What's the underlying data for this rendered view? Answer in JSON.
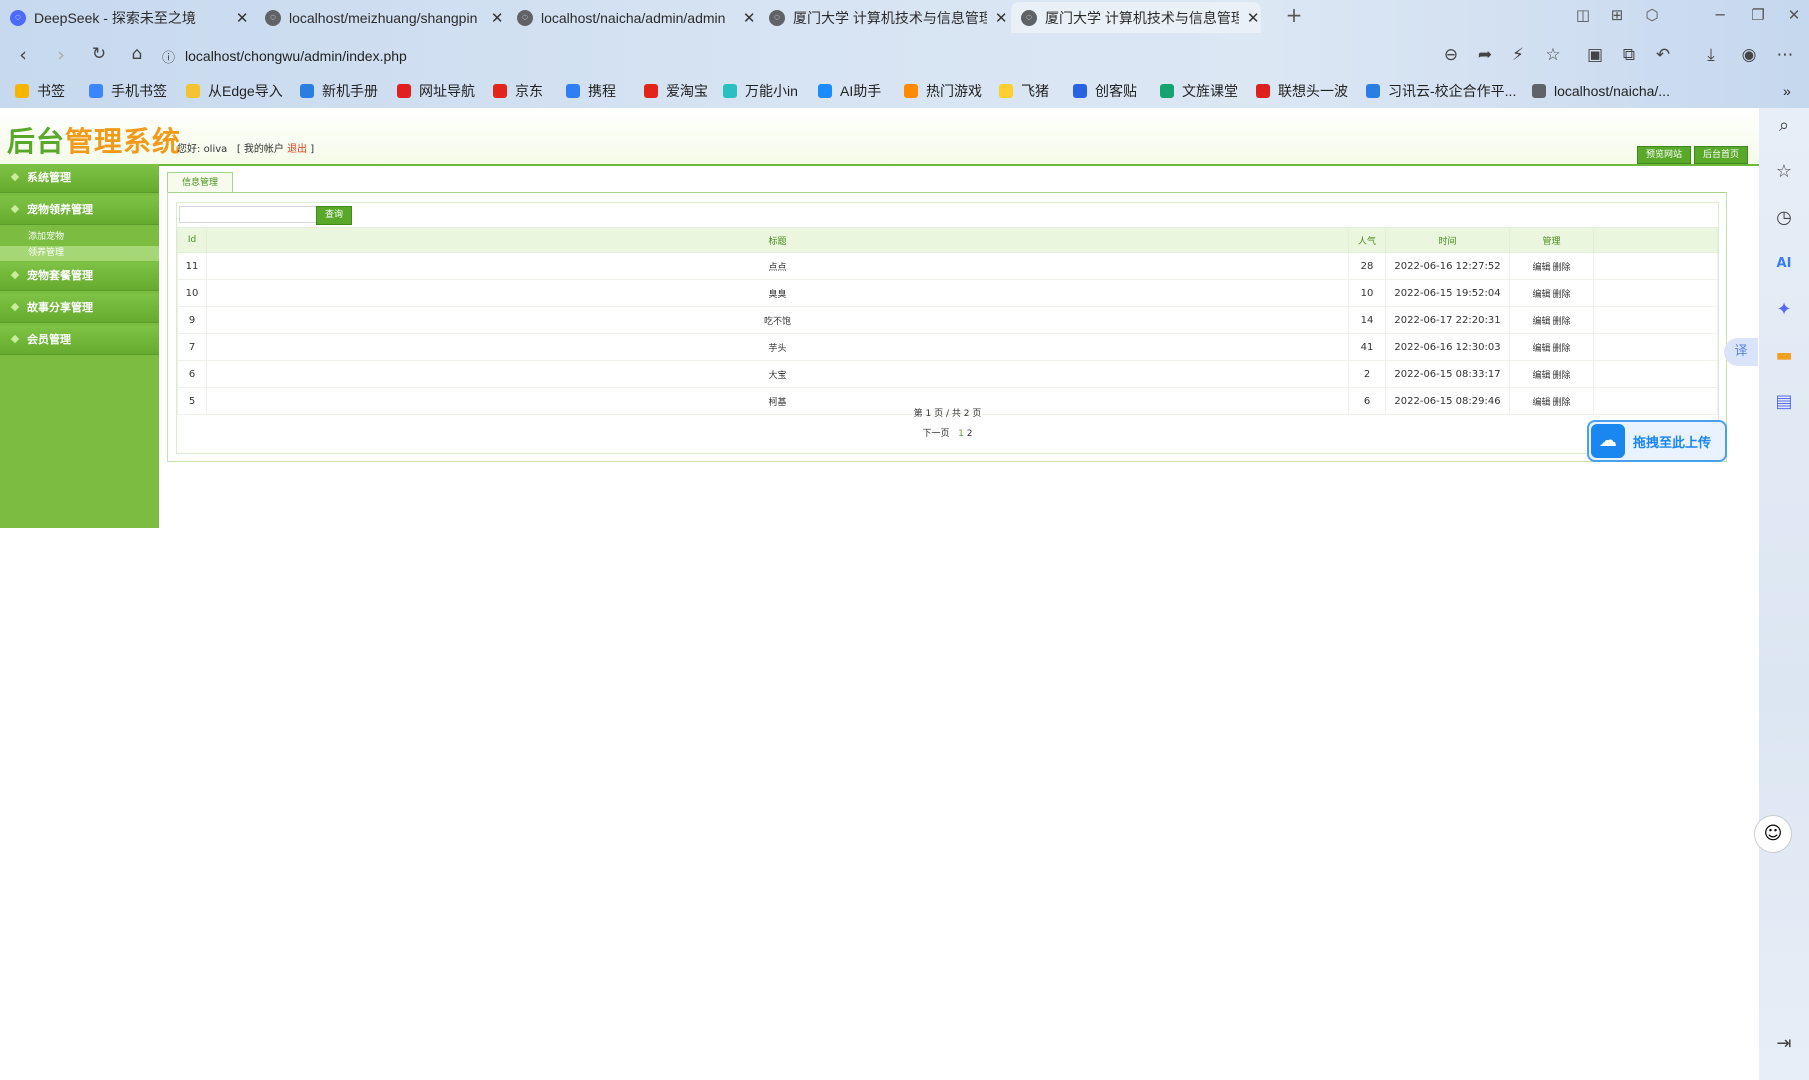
{
  "browser": {
    "tabs": [
      {
        "label": "DeepSeek - 探索未至之境",
        "color": "#4d6bfe"
      },
      {
        "label": "localhost/meizhuang/shangpin",
        "color": "#5f6368"
      },
      {
        "label": "localhost/naicha/admin/admin",
        "color": "#5f6368"
      },
      {
        "label": "厦门大学   计算机技术与信息管理",
        "color": "#5f6368"
      },
      {
        "label": "厦门大学   计算机技术与信息管理",
        "color": "#5f6368"
      }
    ],
    "new_tab": "+",
    "url": "localhost/chongwu/admin/index.php",
    "bookmarks": [
      {
        "label": "书签",
        "color": "#f7b500"
      },
      {
        "label": "手机书签",
        "color": "#3a86ff"
      },
      {
        "label": "从Edge导入",
        "color": "#f4c430"
      },
      {
        "label": "新机手册",
        "color": "#2a7de1"
      },
      {
        "label": "网址导航",
        "color": "#e02020"
      },
      {
        "label": "京东",
        "color": "#e1251b"
      },
      {
        "label": "携程",
        "color": "#2f7ef6"
      },
      {
        "label": "爱淘宝",
        "color": "#e1251b"
      },
      {
        "label": "万能小in",
        "color": "#2ac0c0"
      },
      {
        "label": "AI助手",
        "color": "#1a8cff"
      },
      {
        "label": "热门游戏",
        "color": "#ff8a00"
      },
      {
        "label": "飞猪",
        "color": "#ffcf2e"
      },
      {
        "label": "创客贴",
        "color": "#2b62e3"
      },
      {
        "label": "文旌课堂",
        "color": "#15a36f"
      },
      {
        "label": "联想头一波",
        "color": "#e02020"
      },
      {
        "label": "习讯云-校企合作平...",
        "color": "#2a7de1"
      },
      {
        "label": "localhost/naicha/...",
        "color": "#5f6368"
      }
    ],
    "more": "»"
  },
  "admin": {
    "logo_part1": "后台",
    "logo_part2": "管理系统",
    "welcome_prefix": "您好: ",
    "username": "oliva",
    "account_prefix": "[ 我的帐户 ",
    "logout": "退出",
    "account_suffix": " ]",
    "btn_preview": "预览网站",
    "btn_home": "后台首页",
    "nav": {
      "system": "系统管理",
      "adoption": "宠物领养管理",
      "sub_add": "添加宠物",
      "sub_manage": "领养管理",
      "package": "宠物套餐管理",
      "story": "故事分享管理",
      "member": "会员管理"
    },
    "tab_label": "信息管理",
    "search_btn": "查询",
    "search_value": "",
    "columns": {
      "id": "Id",
      "title": "标题",
      "views": "人气",
      "time": "时间",
      "manage": "管理"
    },
    "rows": [
      {
        "id": "11",
        "title": "点点",
        "views": "28",
        "time": "2022-06-16 12:27:52"
      },
      {
        "id": "10",
        "title": "臭臭",
        "views": "10",
        "time": "2022-06-15 19:52:04"
      },
      {
        "id": "9",
        "title": "吃不饱",
        "views": "14",
        "time": "2022-06-17 22:20:31"
      },
      {
        "id": "7",
        "title": "芋头",
        "views": "41",
        "time": "2022-06-16 12:30:03"
      },
      {
        "id": "6",
        "title": "大宝",
        "views": "2",
        "time": "2022-06-15 08:33:17"
      },
      {
        "id": "5",
        "title": "柯基",
        "views": "6",
        "time": "2022-06-15 08:29:46"
      }
    ],
    "edit": "编辑",
    "delete": "删除",
    "pager_info": "第 1 页 / 共 2 页",
    "pager_next": "下一页",
    "pager_p1": "1",
    "pager_p2": "2"
  },
  "overlay": {
    "upload_label": "拖拽至此上传",
    "translate": "译"
  }
}
